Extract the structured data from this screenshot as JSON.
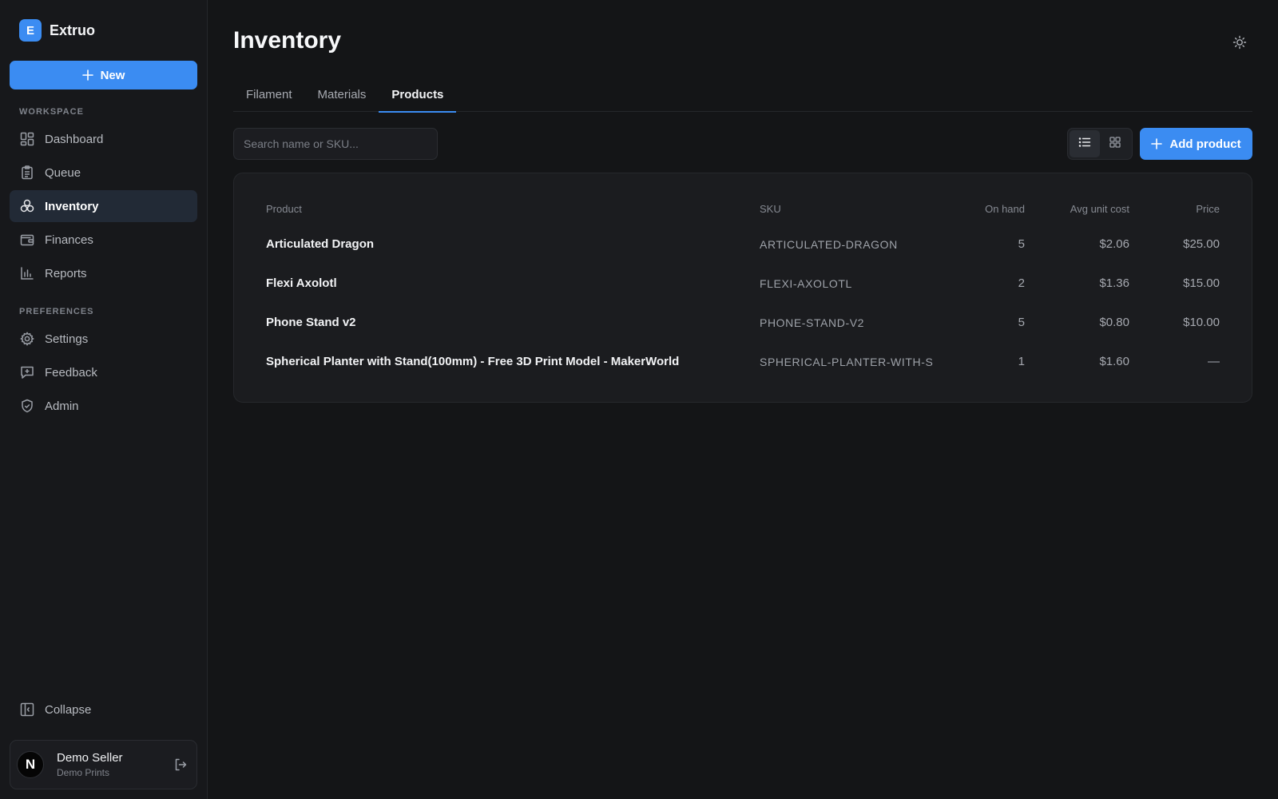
{
  "brand": {
    "logo_letter": "E",
    "name": "Extruo"
  },
  "sidebar": {
    "new_label": "New",
    "workspace_label": "WORKSPACE",
    "workspace_items": [
      {
        "label": "Dashboard",
        "icon": "dashboard-icon"
      },
      {
        "label": "Queue",
        "icon": "clipboard-icon"
      },
      {
        "label": "Inventory",
        "icon": "inventory-icon",
        "active": true
      },
      {
        "label": "Finances",
        "icon": "wallet-icon"
      },
      {
        "label": "Reports",
        "icon": "bar-chart-icon"
      }
    ],
    "preferences_label": "PREFERENCES",
    "preference_items": [
      {
        "label": "Settings",
        "icon": "gear-icon"
      },
      {
        "label": "Feedback",
        "icon": "feedback-icon"
      },
      {
        "label": "Admin",
        "icon": "shield-icon"
      }
    ],
    "collapse_label": "Collapse"
  },
  "user": {
    "avatar_letter": "N",
    "name": "Demo Seller",
    "org": "Demo Prints"
  },
  "main": {
    "title": "Inventory",
    "tabs": [
      {
        "label": "Filament"
      },
      {
        "label": "Materials"
      },
      {
        "label": "Products",
        "active": true
      }
    ],
    "search": {
      "placeholder": "Search name or SKU..."
    },
    "view_mode": "list",
    "add_label": "Add product",
    "table": {
      "headers": [
        "Product",
        "SKU",
        "On hand",
        "Avg unit cost",
        "Price"
      ],
      "rows": [
        {
          "product": "Articulated Dragon",
          "sku": "ARTICULATED-DRAGON",
          "on_hand": "5",
          "avg_unit_cost": "$2.06",
          "price": "$25.00"
        },
        {
          "product": "Flexi Axolotl",
          "sku": "FLEXI-AXOLOTL",
          "on_hand": "2",
          "avg_unit_cost": "$1.36",
          "price": "$15.00"
        },
        {
          "product": "Phone Stand v2",
          "sku": "PHONE-STAND-V2",
          "on_hand": "5",
          "avg_unit_cost": "$0.80",
          "price": "$10.00"
        },
        {
          "product": "Spherical Planter with Stand(100mm) - Free 3D Print Model - MakerWorld",
          "sku": "SPHERICAL-PLANTER-WITH-S",
          "on_hand": "1",
          "avg_unit_cost": "$1.60",
          "price": "—"
        }
      ]
    }
  },
  "colors": {
    "accent": "#3b8cf2",
    "background": "#141517",
    "sidebar": "#17181b",
    "active_nav": "#222a36"
  }
}
